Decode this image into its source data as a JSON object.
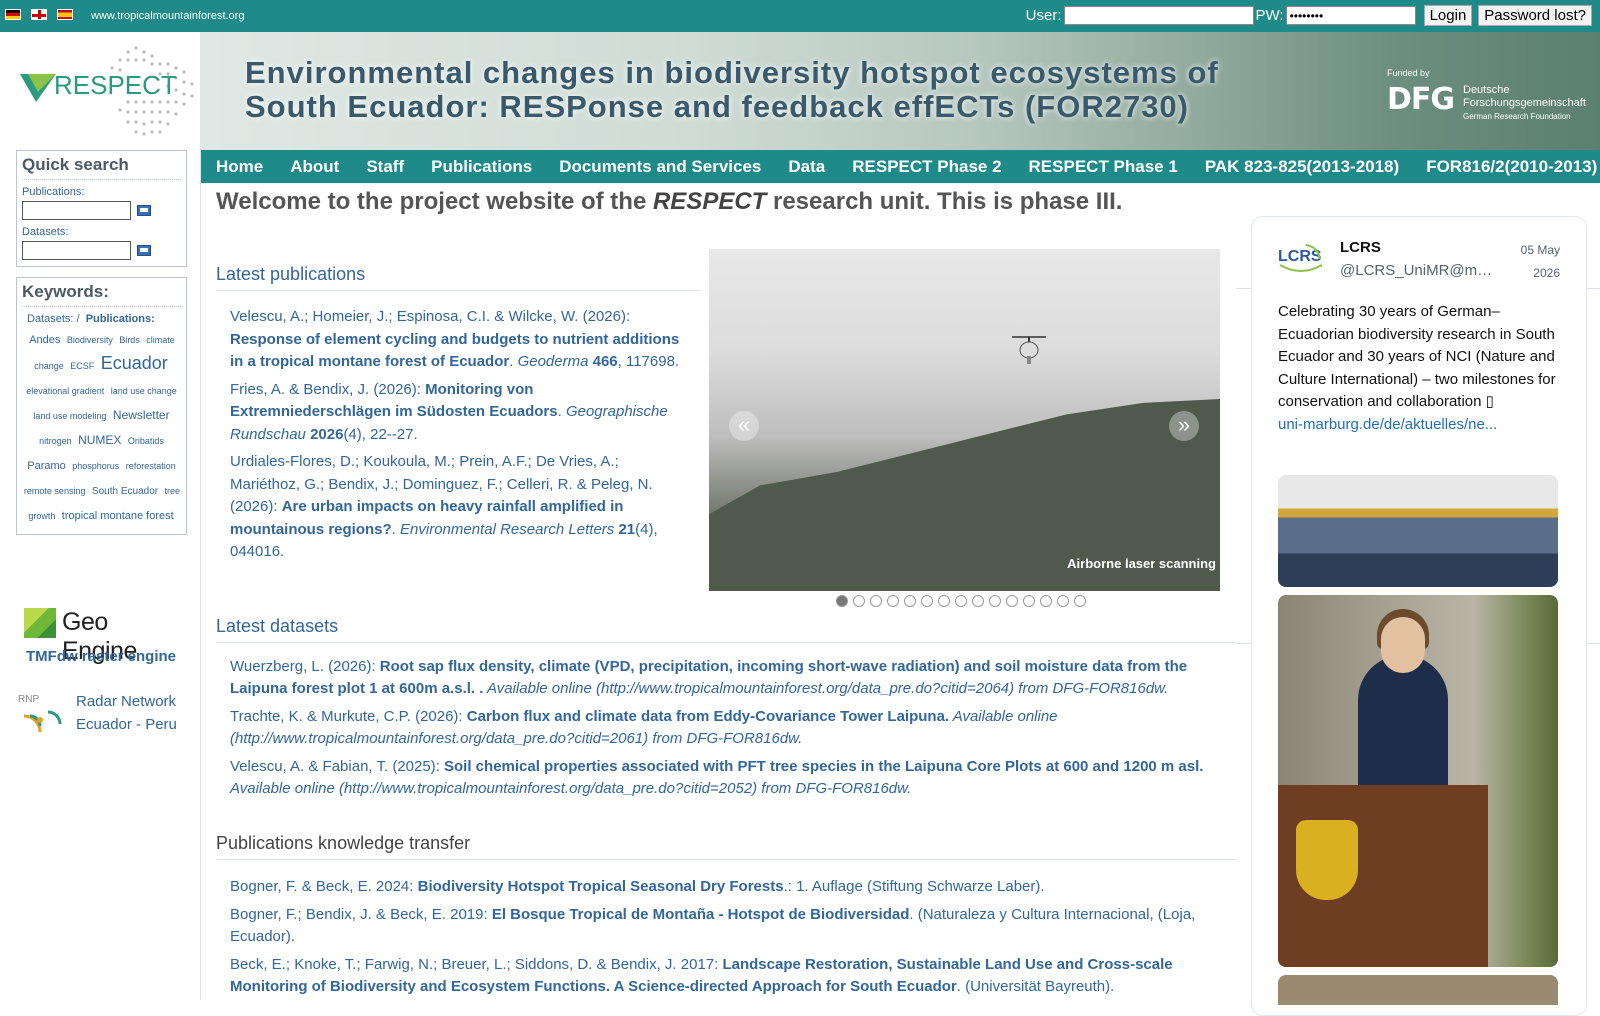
{
  "topbar": {
    "site_url": "www.tropicalmountainforest.org",
    "user_label": "User:",
    "pw_label": "PW:",
    "pw_value": "••••••••",
    "login_button": "Login",
    "password_lost_button": "Password lost?"
  },
  "header": {
    "title_line1": "Environmental changes in biodiversity hotspot ecosystems of",
    "title_line2": "South Ecuador: RESPonse and feedback effECTs (FOR2730)",
    "logo_text": "RESPECT",
    "dfg_funded": "Funded by",
    "dfg_mark": "DFG",
    "dfg_name_line1": "Deutsche",
    "dfg_name_line2": "Forschungsgemeinschaft",
    "dfg_foundation": "German Research Foundation"
  },
  "nav": {
    "items": [
      "Home",
      "About",
      "Staff",
      "Publications",
      "Documents and Services",
      "Data",
      "RESPECT Phase 2",
      "RESPECT Phase 1",
      "PAK 823-825(2013-2018)",
      "FOR816/2(2010-2013)"
    ]
  },
  "sidebar": {
    "quick_search_title": "Quick search",
    "publications_label": "Publications:",
    "datasets_label": "Datasets:",
    "keywords_title": "Keywords:",
    "kw_tab_datasets": "Datasets:",
    "kw_tab_sep": "/",
    "kw_tab_publications": "Publications:",
    "keywords": [
      {
        "text": "Andes",
        "size": 11
      },
      {
        "text": "Biodiversity",
        "size": 9
      },
      {
        "text": "Birds",
        "size": 9
      },
      {
        "text": "climate change",
        "size": 9
      },
      {
        "text": "ECSF",
        "size": 9
      },
      {
        "text": "Ecuador",
        "size": 18
      },
      {
        "text": "elevational gradient",
        "size": 9
      },
      {
        "text": "land use change",
        "size": 9
      },
      {
        "text": "land use modeling",
        "size": 9
      },
      {
        "text": "Newsletter",
        "size": 12
      },
      {
        "text": "nitrogen",
        "size": 9
      },
      {
        "text": "NUMEX",
        "size": 12
      },
      {
        "text": "Oribatids",
        "size": 9
      },
      {
        "text": "Paramo",
        "size": 11
      },
      {
        "text": "phosphorus",
        "size": 9
      },
      {
        "text": "reforestation",
        "size": 9
      },
      {
        "text": "remote sensing",
        "size": 9
      },
      {
        "text": "South Ecuador",
        "size": 10
      },
      {
        "text": "tree growth",
        "size": 9
      },
      {
        "text": "tropical montane forest",
        "size": 11
      }
    ],
    "geoengine_text": "Geo Engine",
    "tmf_text": "TMFdw raster engine",
    "rnp_line1": "Radar Network",
    "rnp_line2": "Ecuador - Peru"
  },
  "main": {
    "welcome_pre": "Welcome to the project website of the ",
    "welcome_em": "RESPECT",
    "welcome_post": " research unit. This is phase III.",
    "latest_publications_title": "Latest publications",
    "publications": [
      {
        "authors": "Velescu, A.; Homeier, J.; Espinosa, C.I. & Wilcke, W. (2026): ",
        "title": "Response of element cycling and budgets to nutrient additions in a tropical montane forest of Ecuador",
        "journal": "Geoderma",
        "volume": "466",
        "rest": ", 117698."
      },
      {
        "authors": "Fries, A. & Bendix, J. (2026): ",
        "title": "Monitoring von Extremniederschlägen im Südosten Ecuadors",
        "journal": "Geographische Rundschau",
        "volume": "2026",
        "rest": "(4), 22--27."
      },
      {
        "authors": "Urdiales-Flores, D.; Koukoula, M.; Prein, A.F.; De Vries, A.; Mariéthoz, G.; Bendix, J.; Dominguez, F.; Celleri, R. & Peleg, N. (2026): ",
        "title": "Are urban impacts on heavy rainfall amplified in mountainous regions?",
        "journal": "Environmental Research Letters",
        "volume": "21",
        "rest": "(4), 044016."
      }
    ],
    "slider_caption": "Airborne laser scanning",
    "slider_prev": "«",
    "slider_next": "»",
    "slider_count": 15,
    "slider_active": 0,
    "latest_datasets_title": "Latest datasets",
    "datasets": [
      {
        "authors": "Wuerzberg, L. (2026): ",
        "title": "Root sap flux density, climate (VPD, precipitation, incoming short-wave radiation) and soil moisture data from the Laipuna forest plot 1 at 600m a.s.l. .",
        "avail": " Available online (http://www.tropicalmountainforest.org/data_pre.do?citid=2064) from DFG-FOR816dw."
      },
      {
        "authors": "Trachte, K. & Murkute, C.P. (2026): ",
        "title": "Carbon flux and climate data from Eddy-Covariance Tower Laipuna.",
        "avail": " Available online (http://www.tropicalmountainforest.org/data_pre.do?citid=2061) from DFG-FOR816dw."
      },
      {
        "authors": "Velescu, A. & Fabian, T. (2025): ",
        "title": "Soil chemical properties associated with PFT tree species in the Laipuna Core Plots at 600 and 1200 m asl.",
        "avail": " Available online (http://www.tropicalmountainforest.org/data_pre.do?citid=2052) from DFG-FOR816dw."
      }
    ],
    "transfer_title": "Publications knowledge transfer",
    "transfer": [
      {
        "authors": "Bogner, F. & Beck, E. 2024: ",
        "title": "Biodiversity Hotspot Tropical Seasonal Dry Forests",
        "rest": ".: 1. Auflage (Stiftung Schwarze Laber)."
      },
      {
        "authors": "Bogner, F.; Bendix, J. & Beck, E. 2019: ",
        "title": "El Bosque Tropical de Montaña - Hotspot de Biodiversidad",
        "rest": ". (Naturaleza y Cultura Internacional, (Loja, Ecuador)."
      },
      {
        "authors": "Beck, E.; Knoke, T.; Farwig, N.; Breuer, L.; Siddons, D. & Bendix, J. 2017: ",
        "title": "Landscape Restoration, Sustainable Land Use and Cross-scale Monitoring of Biodiversity and Ecosystem Functions. A Science-directed Approach for South Ecuador",
        "rest": ". (Universität Bayreuth)."
      }
    ]
  },
  "tweet": {
    "name": "LCRS",
    "handle": "@LCRS_UniMR@m…",
    "date_line1": "05 May",
    "date_line2": "2026",
    "text": "Celebrating 30 years of German–Ecuadorian biodiversity research in South Ecuador and 30 years of NCI (Nature and Culture International) – two milestones for conservation and collaboration ",
    "link": "uni-marburg.de/de/aktuelles/ne..."
  },
  "colors": {
    "teal_bar": "#1f8a8a",
    "link_blue": "#336699",
    "heading_gray": "#555555"
  }
}
